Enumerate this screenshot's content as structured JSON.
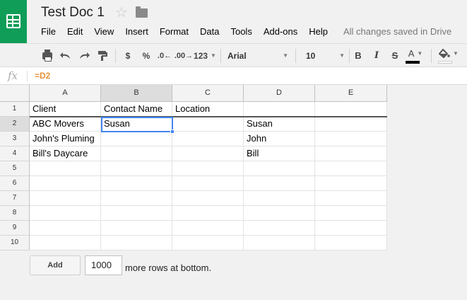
{
  "document": {
    "title": "Test Doc 1",
    "save_status": "All changes saved in Drive"
  },
  "menu": [
    "File",
    "Edit",
    "View",
    "Insert",
    "Format",
    "Data",
    "Tools",
    "Add-ons",
    "Help"
  ],
  "toolbar": {
    "currency_label": "$",
    "percent_label": "%",
    "decrease_decimal_label": ".0←",
    "increase_decimal_label": ".00→",
    "more_formats_label": "123",
    "font_name": "Arial",
    "font_size": "10",
    "bold_label": "B",
    "italic_label": "I",
    "strike_label": "S",
    "text_color_label": "A",
    "text_color": "#000000",
    "fill_color": "#ffffff"
  },
  "formula_bar": {
    "fx_label": "fx",
    "content": "=D2"
  },
  "grid": {
    "columns": [
      "A",
      "B",
      "C",
      "D",
      "E"
    ],
    "selected_column": "B",
    "rows": [
      "1",
      "2",
      "3",
      "4",
      "5",
      "6",
      "7",
      "8",
      "9",
      "10"
    ],
    "selected_row": "2",
    "cells": [
      [
        "Client",
        "Contact Name",
        "Location",
        "",
        ""
      ],
      [
        "ABC Movers",
        "Susan",
        "",
        "Susan",
        ""
      ],
      [
        "John's Pluming",
        "",
        "",
        "John",
        ""
      ],
      [
        "Bill's Daycare",
        "",
        "",
        "Bill",
        ""
      ],
      [
        "",
        "",
        "",
        "",
        ""
      ],
      [
        "",
        "",
        "",
        "",
        ""
      ],
      [
        "",
        "",
        "",
        "",
        ""
      ],
      [
        "",
        "",
        "",
        "",
        ""
      ],
      [
        "",
        "",
        "",
        "",
        ""
      ],
      [
        "",
        "",
        "",
        "",
        ""
      ]
    ],
    "active_cell": "B2"
  },
  "add_rows": {
    "button_label": "Add",
    "count": "1000",
    "suffix": "more rows at bottom."
  },
  "colors": {
    "brand": "#0f9d58",
    "selection": "#4285f4",
    "formula": "#e69138"
  }
}
